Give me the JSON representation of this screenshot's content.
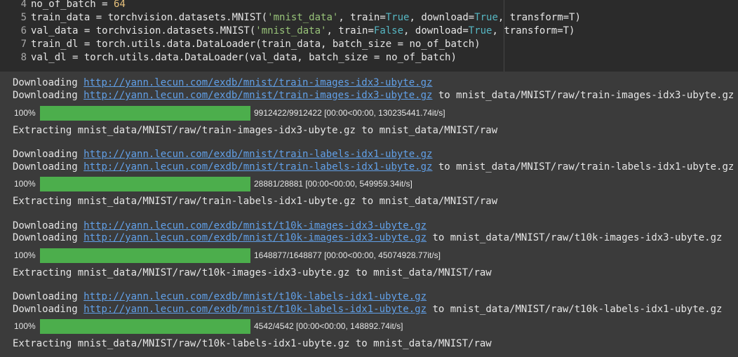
{
  "code": {
    "lines": [
      {
        "no": "4",
        "a": "no_of_batch = ",
        "num": "64"
      },
      {
        "no": "5",
        "a": "train_data = torchvision.datasets.MNIST(",
        "s1": "'mnist_data'",
        "b": ", train=",
        "k1": "True",
        "c": ", download=",
        "k2": "True",
        "d": ", transform=T)"
      },
      {
        "no": "6",
        "a": "val_data = torchvision.datasets.MNIST(",
        "s1": "'mnist_data'",
        "b": ", train=",
        "k1": "False",
        "c": ", download=",
        "k2": "True",
        "d": ", transform=T)"
      },
      {
        "no": "7",
        "text": "train_dl = torch.utils.data.DataLoader(train_data, batch_size = no_of_batch)"
      },
      {
        "no": "8",
        "text": "val_dl = torch.utils.data.DataLoader(val_data, batch_size = no_of_batch)"
      }
    ]
  },
  "output": {
    "downloading_label": "Downloading ",
    "extracting_label": "Extracting ",
    "blocks": [
      {
        "url": "http://yann.lecun.com/exdb/mnist/train-images-idx3-ubyte.gz",
        "dest": " to mnist_data/MNIST/raw/train-images-idx3-ubyte.gz",
        "pct": "100%",
        "progress": 1.0,
        "stats": "9912422/9912422 [00:00<00:00, 130235441.74it/s]",
        "extract": "mnist_data/MNIST/raw/train-images-idx3-ubyte.gz to mnist_data/MNIST/raw"
      },
      {
        "url": "http://yann.lecun.com/exdb/mnist/train-labels-idx1-ubyte.gz",
        "dest": " to mnist_data/MNIST/raw/train-labels-idx1-ubyte.gz",
        "pct": "100%",
        "progress": 1.0,
        "stats": "28881/28881 [00:00<00:00, 549959.34it/s]",
        "extract": "mnist_data/MNIST/raw/train-labels-idx1-ubyte.gz to mnist_data/MNIST/raw"
      },
      {
        "url": "http://yann.lecun.com/exdb/mnist/t10k-images-idx3-ubyte.gz",
        "dest": " to mnist_data/MNIST/raw/t10k-images-idx3-ubyte.gz",
        "pct": "100%",
        "progress": 1.0,
        "stats": "1648877/1648877 [00:00<00:00, 45074928.77it/s]",
        "extract": "mnist_data/MNIST/raw/t10k-images-idx3-ubyte.gz to mnist_data/MNIST/raw"
      },
      {
        "url": "http://yann.lecun.com/exdb/mnist/t10k-labels-idx1-ubyte.gz",
        "dest": " to mnist_data/MNIST/raw/t10k-labels-idx1-ubyte.gz",
        "pct": "100%",
        "progress": 1.0,
        "stats": "4542/4542 [00:00<00:00, 148892.74it/s]",
        "extract": "mnist_data/MNIST/raw/t10k-labels-idx1-ubyte.gz to mnist_data/MNIST/raw"
      }
    ]
  }
}
